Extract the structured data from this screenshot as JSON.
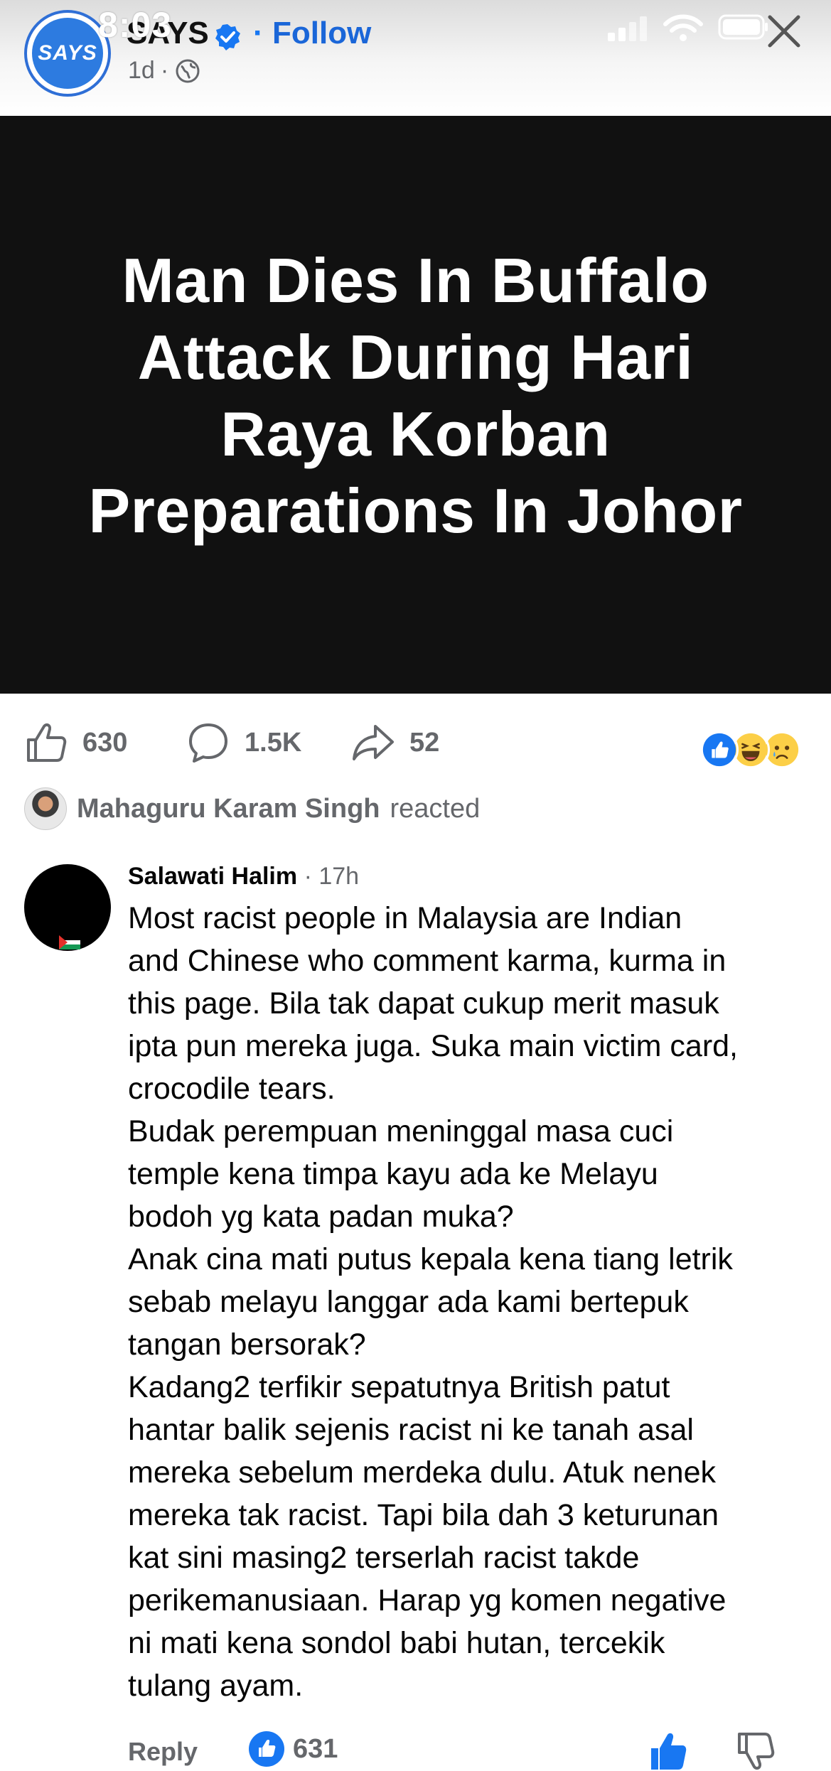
{
  "status_bar": {
    "time": "8:03"
  },
  "header": {
    "avatar_text": "SAYS",
    "page_name": "SAYS",
    "separator": "·",
    "follow_label": "Follow",
    "post_age": "1d",
    "meta_separator": "·",
    "icons": [
      "verified-icon",
      "globe-icon",
      "close-icon",
      "signal-icon",
      "wifi-icon",
      "battery-icon"
    ]
  },
  "hero": {
    "title": "Man Dies In Buffalo Attack During Hari Raya Korban Preparations In Johor",
    "background": "#111111"
  },
  "actions": {
    "likes": "630",
    "comments": "1.5K",
    "shares": "52",
    "reaction_types": [
      "like",
      "haha",
      "sad"
    ]
  },
  "reacted": {
    "name": "Mahaguru Karam Singh",
    "suffix": "reacted"
  },
  "comment": {
    "author": "Salawati Halim",
    "time": "· 17h",
    "lines": [
      "Most racist people in Malaysia are Indian",
      "and Chinese who comment karma, kurma in",
      "this page. Bila tak dapat cukup merit masuk",
      "ipta pun mereka juga. Suka main victim card,",
      "crocodile tears.",
      "Budak perempuan meninggal masa cuci",
      "temple kena timpa kayu ada ke Melayu",
      "bodoh yg kata padan muka?",
      "Anak cina mati putus kepala kena tiang letrik",
      "sebab melayu langgar ada kami bertepuk",
      "tangan bersorak?",
      "Kadang2 terfikir sepatutnya British patut",
      "hantar balik sejenis racist ni ke tanah asal",
      "mereka sebelum merdeka dulu. Atuk nenek",
      "mereka tak racist. Tapi bila dah 3 keturunan",
      "kat sini masing2 terserlah racist takde",
      "perikemanusiaan. Harap yg komen negative",
      "ni mati kena sondol babi hutan, tercekik",
      "tulang ayam."
    ],
    "reply_label": "Reply",
    "like_count": "631"
  },
  "colors": {
    "accent": "#1877f2",
    "follow": "#1a66d8",
    "secondary_text": "#65676b"
  }
}
